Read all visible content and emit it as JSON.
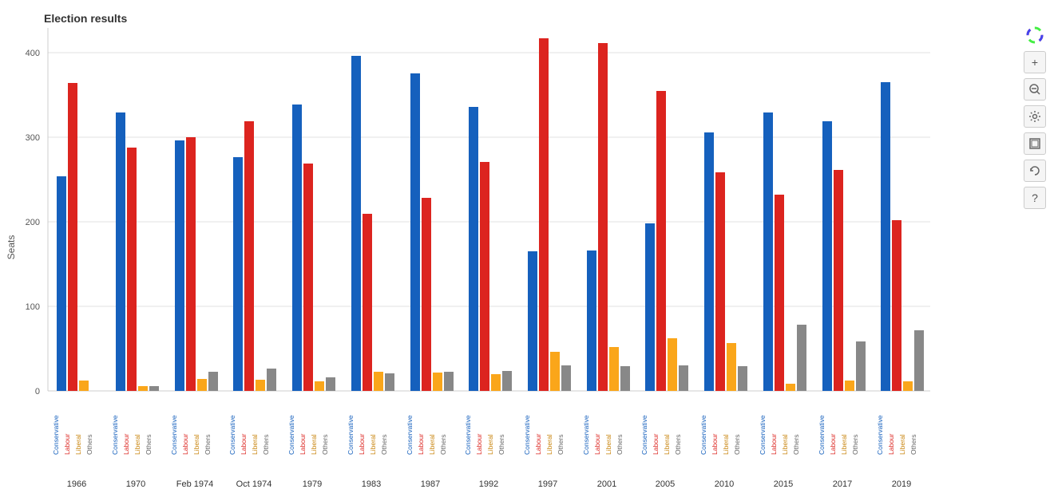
{
  "title": "Election results",
  "yAxisLabel": "Seats",
  "yTicks": [
    0,
    100,
    200,
    300,
    400
  ],
  "elections": [
    {
      "year": "1966",
      "conservative": 253,
      "labour": 364,
      "liberal": 12,
      "others": 0
    },
    {
      "year": "1970",
      "conservative": 330,
      "labour": 288,
      "liberal": 6,
      "others": 6
    },
    {
      "year": "Feb 1974",
      "conservative": 297,
      "labour": 301,
      "liberal": 14,
      "others": 23
    },
    {
      "year": "Oct 1974",
      "conservative": 277,
      "labour": 319,
      "liberal": 13,
      "others": 26
    },
    {
      "year": "1979",
      "conservative": 339,
      "labour": 269,
      "liberal": 11,
      "others": 16
    },
    {
      "year": "1983",
      "conservative": 397,
      "labour": 209,
      "liberal": 23,
      "others": 21
    },
    {
      "year": "1987",
      "conservative": 376,
      "labour": 229,
      "liberal": 22,
      "others": 23
    },
    {
      "year": "1992",
      "conservative": 336,
      "labour": 271,
      "liberal": 20,
      "others": 24
    },
    {
      "year": "1997",
      "conservative": 165,
      "labour": 418,
      "liberal": 46,
      "others": 30
    },
    {
      "year": "2001",
      "conservative": 166,
      "labour": 412,
      "liberal": 52,
      "others": 29
    },
    {
      "year": "2005",
      "conservative": 198,
      "labour": 355,
      "liberal": 62,
      "others": 30
    },
    {
      "year": "2010",
      "conservative": 306,
      "labour": 258,
      "liberal": 57,
      "others": 29
    },
    {
      "year": "2015",
      "conservative": 331,
      "labour": 232,
      "liberal": 8,
      "others": 79
    },
    {
      "year": "2017",
      "conservative": 317,
      "labour": 262,
      "liberal": 12,
      "others": 59
    },
    {
      "year": "2019",
      "conservative": 365,
      "labour": 202,
      "liberal": 11,
      "others": 72
    }
  ],
  "colors": {
    "conservative": "#1560bd",
    "labour": "#dc241f",
    "liberal": "#FAA61A",
    "others": "#888888"
  },
  "toolbar": {
    "buttons": [
      "🎨",
      "+",
      "🔍",
      "⚙️",
      "⊞",
      "↺",
      "?"
    ]
  }
}
